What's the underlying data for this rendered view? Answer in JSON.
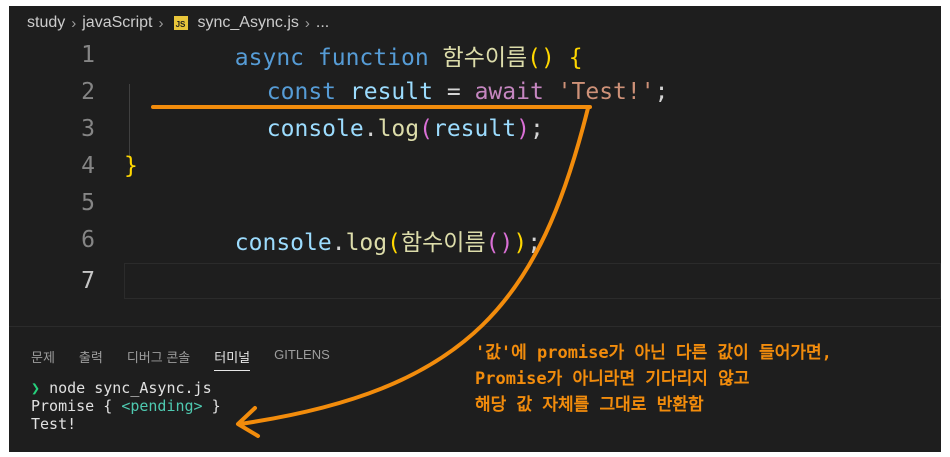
{
  "breadcrumb": {
    "items": [
      "study",
      "javaScript"
    ],
    "file_badge": "JS",
    "file": "sync_Async.js",
    "trailing": "..."
  },
  "editor": {
    "line_numbers": [
      "1",
      "2",
      "3",
      "4",
      "5",
      "6",
      "7"
    ],
    "lines": {
      "l1": {
        "async": "async",
        "function": "function",
        "name": "함수이름",
        "parens": "()",
        "brace": "{"
      },
      "l2": {
        "const": "const",
        "result": "result",
        "eq": "=",
        "await": "await",
        "str": "'Test!'",
        "semi": ";"
      },
      "l3": {
        "console": "console",
        "dot": ".",
        "log": "log",
        "open": "(",
        "arg": "result",
        "close": ")",
        "semi": ";"
      },
      "l4": {
        "brace": "}"
      },
      "l6": {
        "console": "console",
        "dot": ".",
        "log": "log",
        "open": "(",
        "name": "함수이름",
        "parens": "()",
        "close": ")",
        "semi": ";"
      }
    }
  },
  "panel": {
    "tabs": [
      "문제",
      "출력",
      "디버그 콘솔",
      "터미널",
      "GITLENS"
    ],
    "active_tab": "터미널",
    "terminal": {
      "prompt_symbol": "❯",
      "command": "node sync_Async.js",
      "out1_prefix": "Promise {",
      "out1_pending": "<pending>",
      "out1_suffix": "}",
      "out2": "Test!"
    }
  },
  "annotation": {
    "lines": [
      "'값'에 promise가 아닌 다른 값이 들어가면,",
      "Promise가 아니라면 기다리지 않고",
      "해당 값 자체를 그대로 반환함"
    ],
    "color": "#f28c0c"
  }
}
